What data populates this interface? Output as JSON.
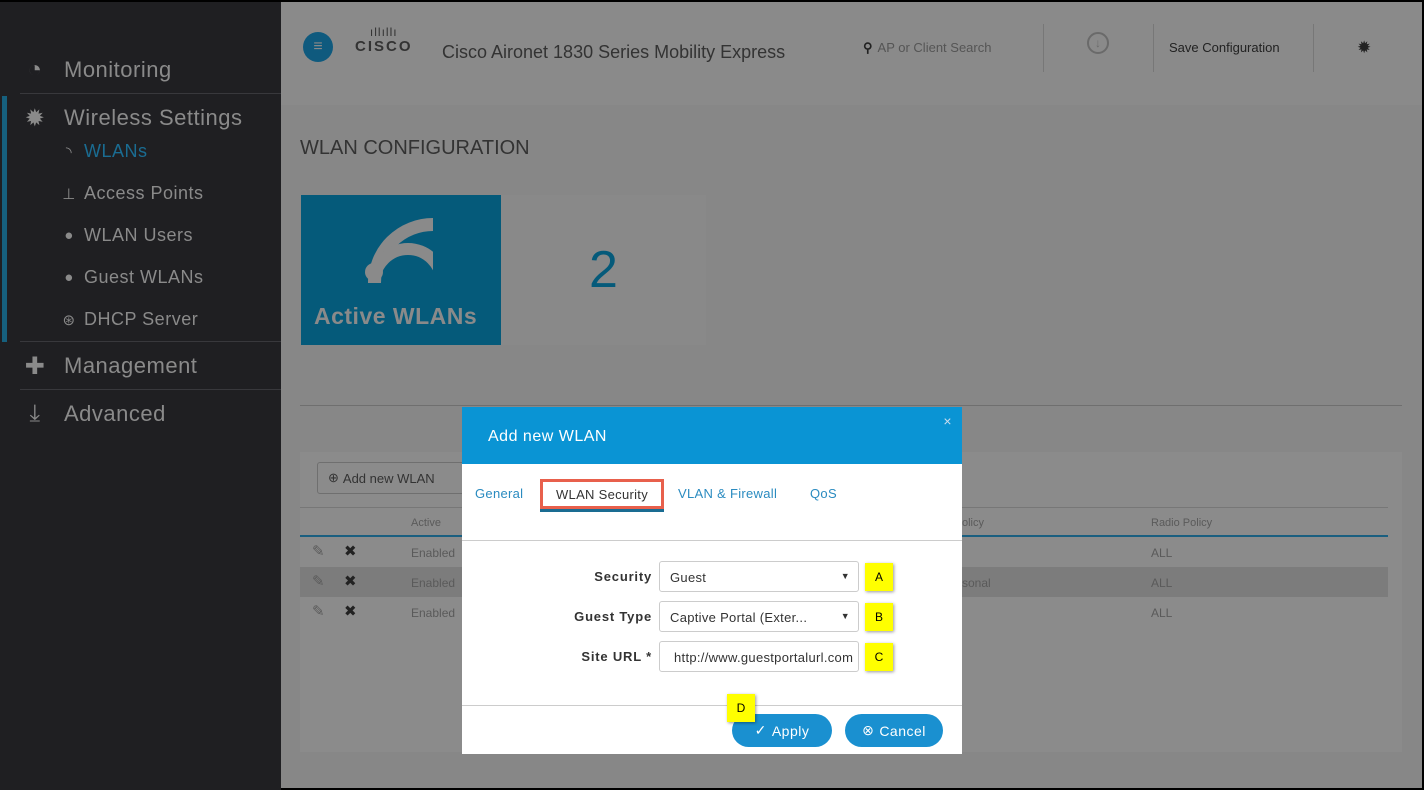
{
  "sidebar": {
    "items": [
      {
        "label": "Monitoring",
        "icon": "dashboard-icon"
      },
      {
        "label": "Wireless Settings",
        "icon": "gear-icon",
        "children": [
          {
            "label": "WLANs",
            "icon": "wifi-icon",
            "active": true
          },
          {
            "label": "Access Points",
            "icon": "access-point-icon"
          },
          {
            "label": "WLAN Users",
            "icon": "users-icon"
          },
          {
            "label": "Guest WLANs",
            "icon": "users-icon"
          },
          {
            "label": "DHCP Server",
            "icon": "dhcp-icon"
          }
        ]
      },
      {
        "label": "Management",
        "icon": "puzzle-icon"
      },
      {
        "label": "Advanced",
        "icon": "download-icon"
      }
    ]
  },
  "header": {
    "logo": "CISCO",
    "title": "Cisco Aironet 1830 Series Mobility Express",
    "search_placeholder": "AP or Client Search",
    "save": "Save Configuration"
  },
  "page": {
    "title": "WLAN CONFIGURATION",
    "tile_label": "Active WLANs",
    "tile_value": "2"
  },
  "table": {
    "add_button": "Add new WLAN",
    "headers": [
      "Active",
      "olicy",
      "Radio Policy"
    ],
    "rows": [
      [
        "Enabled",
        "",
        "ALL"
      ],
      [
        "Enabled",
        "sonal",
        "ALL"
      ],
      [
        "Enabled",
        "",
        "ALL"
      ]
    ]
  },
  "modal": {
    "title": "Add new WLAN",
    "close": "×",
    "tabs": [
      "General",
      "WLAN Security",
      "VLAN & Firewall",
      "QoS"
    ],
    "fields": {
      "security_label": "Security",
      "security_value": "Guest",
      "guest_type_label": "Guest Type",
      "guest_type_value": "Captive Portal (Exter...",
      "site_url_label": "Site URL *",
      "site_url_value": "http://www.guestportalurl.com"
    },
    "apply": "Apply",
    "cancel": "Cancel"
  },
  "callouts": [
    "A",
    "B",
    "C",
    "D"
  ],
  "colors": {
    "accent": "#0a94d4",
    "highlight": "#e8604c",
    "callout": "#ffff00"
  }
}
